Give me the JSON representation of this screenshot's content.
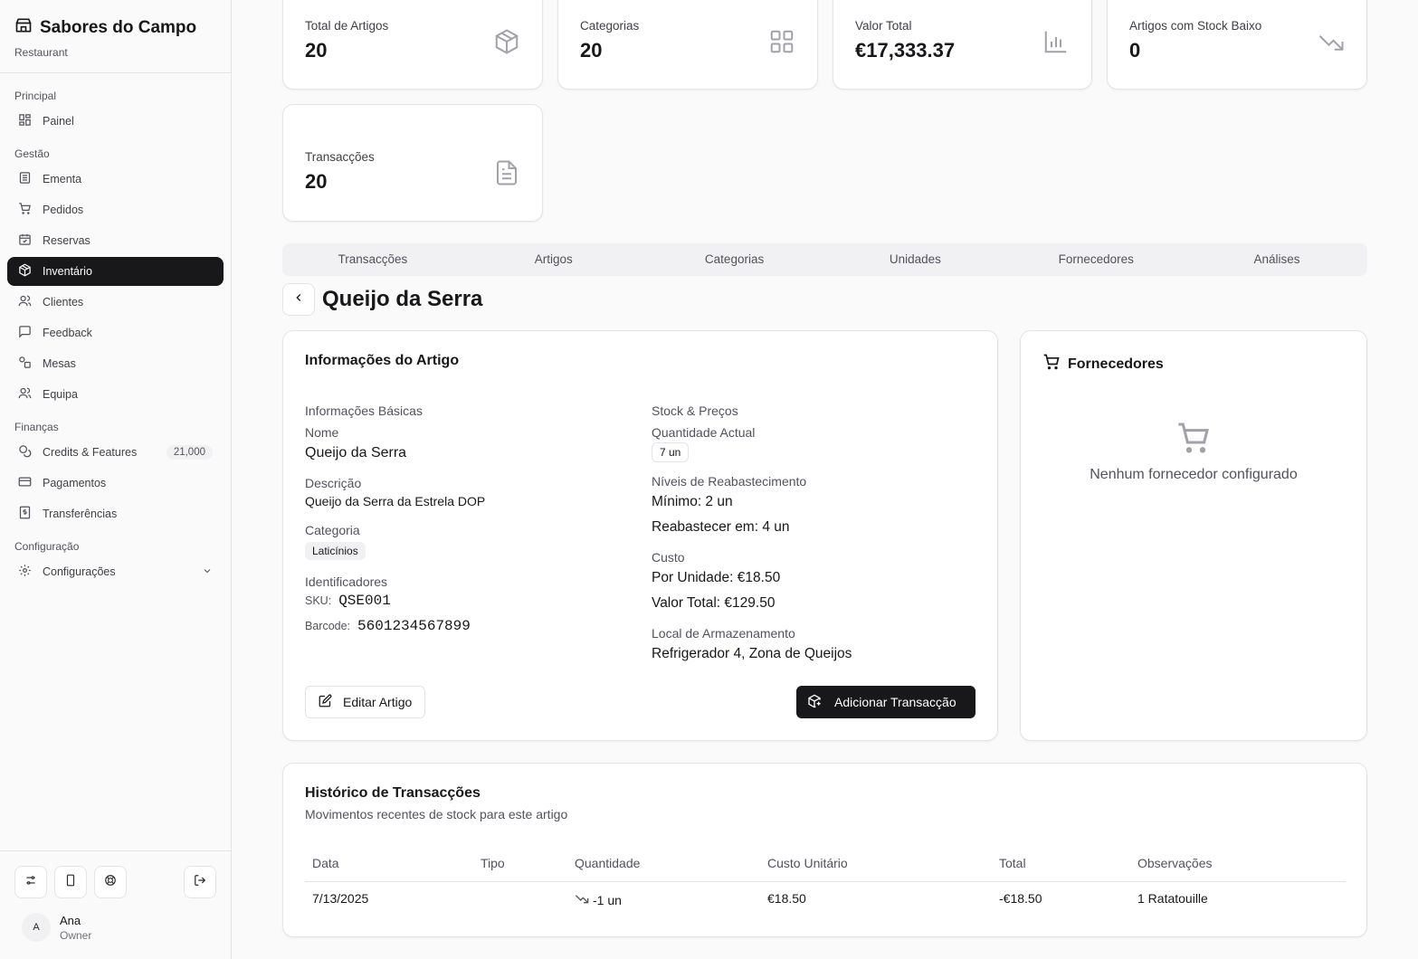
{
  "sidebar": {
    "brand": {
      "title": "Sabores do Campo",
      "subtitle": "Restaurant"
    },
    "groups": [
      {
        "label": "Principal"
      },
      {
        "label": "Gestão"
      },
      {
        "label": "Finanças"
      },
      {
        "label": "Configuração"
      }
    ],
    "items": [
      {
        "label": "Painel",
        "icon": "grid-icon"
      },
      {
        "label": "Ementa",
        "icon": "menu-list-icon"
      },
      {
        "label": "Pedidos",
        "icon": "cart-icon"
      },
      {
        "label": "Reservas",
        "icon": "calendar-icon"
      },
      {
        "label": "Inventário",
        "icon": "package-icon",
        "active": true
      },
      {
        "label": "Clientes",
        "icon": "users-icon"
      },
      {
        "label": "Feedback",
        "icon": "message-icon"
      },
      {
        "label": "Mesas",
        "icon": "shapes-icon"
      },
      {
        "label": "Equipa",
        "icon": "team-icon"
      },
      {
        "label": "Credits & Features",
        "icon": "coins-icon",
        "badge": "21,000"
      },
      {
        "label": "Pagamentos",
        "icon": "credit-card-icon"
      },
      {
        "label": "Transferências",
        "icon": "receipt-icon"
      },
      {
        "label": "Configurações",
        "icon": "gear-icon"
      }
    ],
    "user": {
      "initial": "A",
      "name": "Ana",
      "role": "Owner"
    }
  },
  "stats": [
    {
      "label": "Total de Artigos",
      "value": "20",
      "icon": "package-icon"
    },
    {
      "label": "Categorias",
      "value": "20",
      "icon": "grid-icon"
    },
    {
      "label": "Valor Total",
      "value": "€17,333.37",
      "icon": "bar-chart-icon"
    },
    {
      "label": "Artigos com Stock Baixo",
      "value": "0",
      "icon": "trending-down-icon"
    },
    {
      "label": "Transacções",
      "value": "20",
      "icon": "file-text-icon"
    }
  ],
  "tabs": [
    "Transacções",
    "Artigos",
    "Categorias",
    "Unidades",
    "Fornecedores",
    "Análises"
  ],
  "page_title": "Queijo da Serra",
  "item_info": {
    "title": "Informações do Artigo",
    "basic": {
      "heading": "Informações Básicas",
      "name_label": "Nome",
      "name": "Queijo da Serra",
      "desc_label": "Descrição",
      "desc": "Queijo da Serra da Estrela DOP",
      "category_label": "Categoria",
      "category": "Laticínios",
      "ids_label": "Identificadores",
      "sku_label": "SKU:",
      "sku": "QSE001",
      "barcode_label": "Barcode:",
      "barcode": "5601234567899"
    },
    "stock": {
      "heading": "Stock & Preços",
      "qty_label": "Quantidade Actual",
      "qty": "7 un",
      "levels_label": "Níveis de Reabastecimento",
      "min": "Mínimo: 2 un",
      "reorder": "Reabastecer em: 4 un",
      "cost_label": "Custo",
      "unit_cost": "Por Unidade: €18.50",
      "total_value": "Valor Total: €129.50",
      "location_label": "Local de Armazenamento",
      "location": "Refrigerador 4, Zona de Queijos"
    },
    "edit_button": "Editar Artigo",
    "add_button": "Adicionar Transacção"
  },
  "suppliers": {
    "title": "Fornecedores",
    "empty": "Nenhum fornecedor configurado"
  },
  "history": {
    "title": "Histórico de Transacções",
    "subtitle": "Movimentos recentes de stock para este artigo",
    "columns": [
      "Data",
      "Tipo",
      "Quantidade",
      "Custo Unitário",
      "Total",
      "Observações"
    ],
    "rows": [
      {
        "date": "7/13/2025",
        "type": "",
        "qty": "-1 un",
        "unit_cost": "€18.50",
        "total": "-€18.50",
        "notes": "1 Ratatouille"
      }
    ]
  }
}
